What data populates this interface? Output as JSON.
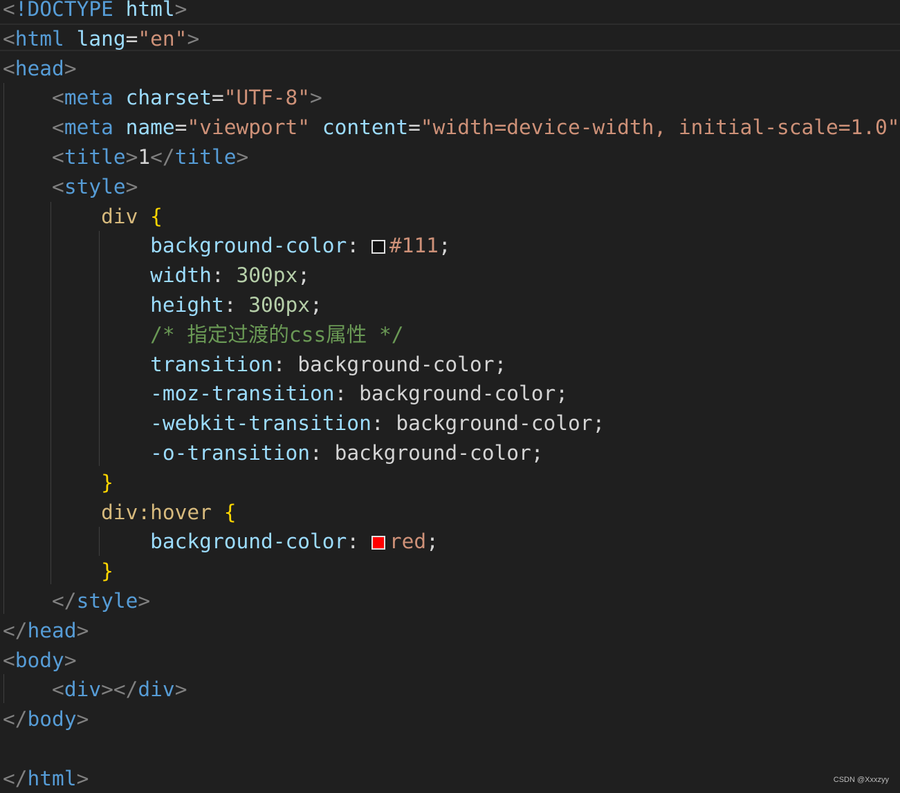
{
  "editor": {
    "lines": [
      {
        "id": "l1",
        "tokens": [
          [
            "<",
            "punc"
          ],
          [
            "!DOCTYPE",
            "tag"
          ],
          [
            " ",
            "text"
          ],
          [
            "html",
            "attr"
          ],
          [
            ">",
            "punc"
          ]
        ]
      },
      {
        "id": "l2",
        "tokens": [
          [
            "<",
            "punc"
          ],
          [
            "html",
            "tag"
          ],
          [
            " ",
            "text"
          ],
          [
            "lang",
            "attr"
          ],
          [
            "=",
            "text"
          ],
          [
            "\"en\"",
            "str"
          ],
          [
            ">",
            "punc"
          ]
        ]
      },
      {
        "id": "l3",
        "tokens": [
          [
            "<",
            "punc"
          ],
          [
            "head",
            "tag"
          ],
          [
            ">",
            "punc"
          ]
        ]
      },
      {
        "id": "l4",
        "tokens": [
          [
            "    ",
            "text"
          ],
          [
            "<",
            "punc"
          ],
          [
            "meta",
            "tag"
          ],
          [
            " ",
            "text"
          ],
          [
            "charset",
            "attr"
          ],
          [
            "=",
            "text"
          ],
          [
            "\"UTF-8\"",
            "str"
          ],
          [
            ">",
            "punc"
          ]
        ]
      },
      {
        "id": "l5",
        "tokens": [
          [
            "    ",
            "text"
          ],
          [
            "<",
            "punc"
          ],
          [
            "meta",
            "tag"
          ],
          [
            " ",
            "text"
          ],
          [
            "name",
            "attr"
          ],
          [
            "=",
            "text"
          ],
          [
            "\"viewport\"",
            "str"
          ],
          [
            " ",
            "text"
          ],
          [
            "content",
            "attr"
          ],
          [
            "=",
            "text"
          ],
          [
            "\"width=device-width, initial-scale=1.0\"",
            "str"
          ],
          [
            ">",
            "punc"
          ]
        ]
      },
      {
        "id": "l6",
        "tokens": [
          [
            "    ",
            "text"
          ],
          [
            "<",
            "punc"
          ],
          [
            "title",
            "tag"
          ],
          [
            ">",
            "punc"
          ],
          [
            "1",
            "text"
          ],
          [
            "</",
            "punc"
          ],
          [
            "title",
            "tag"
          ],
          [
            ">",
            "punc"
          ]
        ]
      },
      {
        "id": "l7",
        "tokens": [
          [
            "    ",
            "text"
          ],
          [
            "<",
            "punc"
          ],
          [
            "style",
            "tag"
          ],
          [
            ">",
            "punc"
          ]
        ]
      },
      {
        "id": "l8",
        "tokens": [
          [
            "        ",
            "text"
          ],
          [
            "div",
            "sel"
          ],
          [
            " ",
            "text"
          ],
          [
            "{",
            "brace"
          ]
        ]
      },
      {
        "id": "l9",
        "tokens": [
          [
            "            ",
            "text"
          ],
          [
            "background-color",
            "prop"
          ],
          [
            ": ",
            "text"
          ],
          [
            "SWATCH",
            "swatch-dark"
          ],
          [
            "#111",
            "str"
          ],
          [
            ";",
            "text"
          ]
        ]
      },
      {
        "id": "l10",
        "tokens": [
          [
            "            ",
            "text"
          ],
          [
            "width",
            "prop"
          ],
          [
            ": ",
            "text"
          ],
          [
            "300px",
            "num"
          ],
          [
            ";",
            "text"
          ]
        ]
      },
      {
        "id": "l11",
        "tokens": [
          [
            "            ",
            "text"
          ],
          [
            "height",
            "prop"
          ],
          [
            ": ",
            "text"
          ],
          [
            "300px",
            "num"
          ],
          [
            ";",
            "text"
          ]
        ]
      },
      {
        "id": "l12",
        "tokens": [
          [
            "            ",
            "text"
          ],
          [
            "/* 指定过渡的css属性 */",
            "comment"
          ]
        ]
      },
      {
        "id": "l13",
        "tokens": [
          [
            "            ",
            "text"
          ],
          [
            "transition",
            "prop"
          ],
          [
            ": ",
            "text"
          ],
          [
            "background-color",
            "text"
          ],
          [
            ";",
            "text"
          ]
        ]
      },
      {
        "id": "l14",
        "tokens": [
          [
            "            ",
            "text"
          ],
          [
            "-moz-transition",
            "prop"
          ],
          [
            ": ",
            "text"
          ],
          [
            "background-color",
            "text"
          ],
          [
            ";",
            "text"
          ]
        ]
      },
      {
        "id": "l15",
        "tokens": [
          [
            "            ",
            "text"
          ],
          [
            "-webkit-transition",
            "prop"
          ],
          [
            ": ",
            "text"
          ],
          [
            "background-color",
            "text"
          ],
          [
            ";",
            "text"
          ]
        ]
      },
      {
        "id": "l16",
        "tokens": [
          [
            "            ",
            "text"
          ],
          [
            "-o-transition",
            "prop"
          ],
          [
            ": ",
            "text"
          ],
          [
            "background-color",
            "text"
          ],
          [
            ";",
            "text"
          ]
        ]
      },
      {
        "id": "l17",
        "tokens": [
          [
            "        ",
            "text"
          ],
          [
            "}",
            "brace"
          ]
        ]
      },
      {
        "id": "l18",
        "tokens": [
          [
            "        ",
            "text"
          ],
          [
            "div:hover",
            "sel"
          ],
          [
            " ",
            "text"
          ],
          [
            "{",
            "brace"
          ]
        ]
      },
      {
        "id": "l19",
        "tokens": [
          [
            "            ",
            "text"
          ],
          [
            "background-color",
            "prop"
          ],
          [
            ": ",
            "text"
          ],
          [
            "SWATCH",
            "swatch-red"
          ],
          [
            "red",
            "str"
          ],
          [
            ";",
            "text"
          ]
        ]
      },
      {
        "id": "l20",
        "tokens": [
          [
            "        ",
            "text"
          ],
          [
            "}",
            "brace"
          ]
        ]
      },
      {
        "id": "l21",
        "tokens": [
          [
            "    ",
            "text"
          ],
          [
            "</",
            "punc"
          ],
          [
            "style",
            "tag"
          ],
          [
            ">",
            "punc"
          ]
        ]
      },
      {
        "id": "l22",
        "tokens": [
          [
            "</",
            "punc"
          ],
          [
            "head",
            "tag"
          ],
          [
            ">",
            "punc"
          ]
        ]
      },
      {
        "id": "l23",
        "tokens": [
          [
            "<",
            "punc"
          ],
          [
            "body",
            "tag"
          ],
          [
            ">",
            "punc"
          ]
        ]
      },
      {
        "id": "l24",
        "tokens": [
          [
            "    ",
            "text"
          ],
          [
            "<",
            "punc"
          ],
          [
            "div",
            "tag"
          ],
          [
            "></",
            "punc"
          ],
          [
            "div",
            "tag"
          ],
          [
            ">",
            "punc"
          ]
        ]
      },
      {
        "id": "l25",
        "tokens": [
          [
            "</",
            "punc"
          ],
          [
            "body",
            "tag"
          ],
          [
            ">",
            "punc"
          ]
        ]
      },
      {
        "id": "l26",
        "tokens": []
      },
      {
        "id": "l27",
        "tokens": [
          [
            "</",
            "punc"
          ],
          [
            "html",
            "tag"
          ],
          [
            ">",
            "punc"
          ]
        ]
      }
    ],
    "swatch_colors": {
      "swatch-dark": "#111111",
      "swatch-red": "#ff0000"
    }
  },
  "watermark": "CSDN @Xxxzyy"
}
